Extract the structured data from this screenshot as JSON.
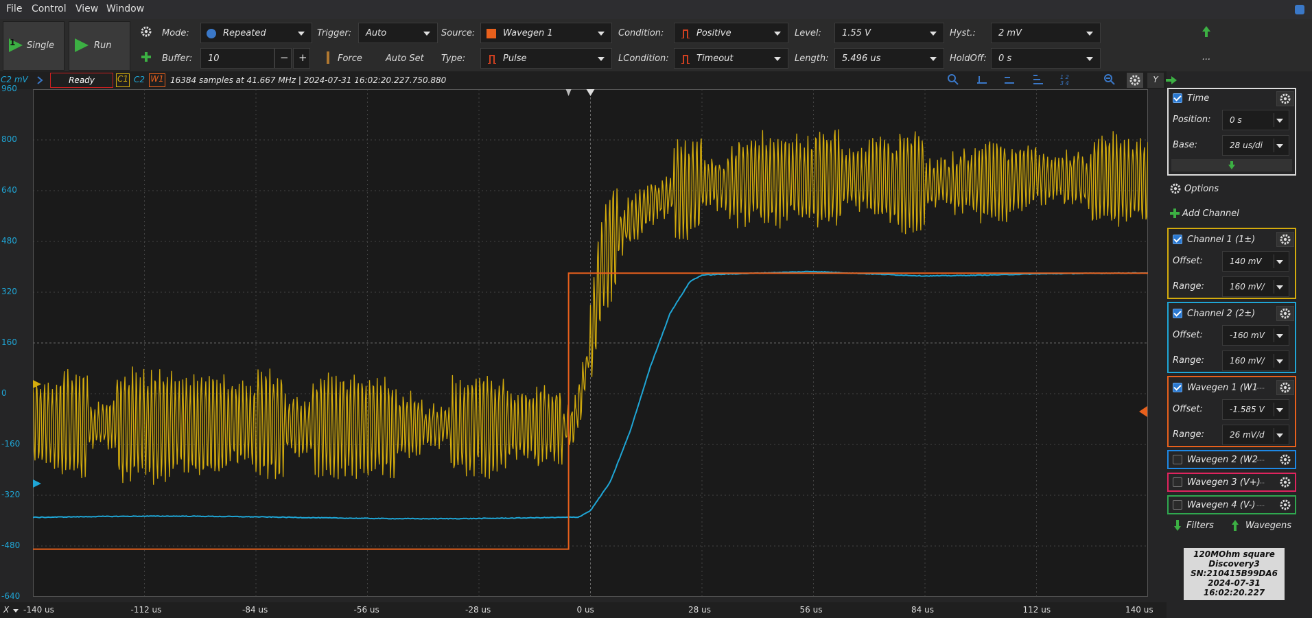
{
  "menu": {
    "items": [
      "File",
      "Control",
      "View",
      "Window"
    ]
  },
  "toolbar": {
    "single": "Single",
    "single_badge": "1",
    "run": "Run",
    "mode_label": "Mode:",
    "mode_value": "Repeated",
    "trigger_label": "Trigger:",
    "trigger_value": "Auto",
    "source_label": "Source:",
    "source_value": "Wavegen 1",
    "condition_label": "Condition:",
    "condition_value": "Positive",
    "level_label": "Level:",
    "level_value": "1.55 V",
    "hyst_label": "Hyst.:",
    "hyst_value": "2 mV",
    "buffer_label": "Buffer:",
    "buffer_value": "10",
    "force": "Force",
    "autoset": "Auto Set",
    "type_label": "Type:",
    "type_value": "Pulse",
    "lcondition_label": "LCondition:",
    "lcondition_value": "Timeout",
    "length_label": "Length:",
    "length_value": "5.496 us",
    "holdoff_label": "HoldOff:",
    "holdoff_value": "0 s",
    "more": "..."
  },
  "status": {
    "axis_unit": "C2 mV",
    "state": "Ready",
    "c1": "C1",
    "c2": "C2",
    "w1": "W1",
    "info": "16384 samples at 41.667 MHz  | 2024-07-31 16:02:20.227.750.880",
    "y_label": "Y"
  },
  "yaxis": {
    "ticks": [
      "960",
      "800",
      "640",
      "480",
      "320",
      "160",
      "0",
      "-160",
      "-320",
      "-480",
      "-640"
    ]
  },
  "xaxis": {
    "label": "X",
    "ticks": [
      "-140 us",
      "-112 us",
      "-84 us",
      "-56 us",
      "-28 us",
      "0 us",
      "28 us",
      "56 us",
      "84 us",
      "112 us",
      "140 us"
    ]
  },
  "colors": {
    "c1": "#d4ac0d",
    "c2": "#1fa6d6",
    "w1": "#e8601c",
    "wg2": "#1e88e5",
    "wg3": "#e0245e",
    "wg4": "#2fa84f",
    "time": "#dddddd"
  },
  "side": {
    "time": {
      "title": "Time",
      "position_label": "Position:",
      "position_value": "0 s",
      "base_label": "Base:",
      "base_value": "28 us/di"
    },
    "options": "Options",
    "add_channel": "Add Channel",
    "ch1": {
      "title": "Channel 1 (1±)",
      "offset_label": "Offset:",
      "offset_value": "140 mV",
      "range_label": "Range:",
      "range_value": "160 mV/"
    },
    "ch2": {
      "title": "Channel 2 (2±)",
      "offset_label": "Offset:",
      "offset_value": "-160 mV",
      "range_label": "Range:",
      "range_value": "160 mV/"
    },
    "wg1": {
      "title": "Wavegen 1 (W1",
      "offset_label": "Offset:",
      "offset_value": "-1.585 V",
      "range_label": "Range:",
      "range_value": "26 mV/d"
    },
    "wg2": {
      "title": "Wavegen 2 (W2"
    },
    "wg3": {
      "title": "Wavegen 3 (V+)"
    },
    "wg4": {
      "title": "Wavegen 4 (V-)"
    },
    "dashes": "---",
    "filters": "Filters",
    "wavegens": "Wavegens"
  },
  "device": {
    "line1": "120MOhm square",
    "line2": "Discovery3",
    "line3": "SN:210415B99DA6",
    "line4": "2024-07-31 16:02:20.227"
  },
  "chart_data": {
    "type": "line",
    "x_unit": "us",
    "xlim": [
      -140,
      140
    ],
    "ylim": [
      -640,
      960
    ],
    "grid": true,
    "series": [
      {
        "name": "C1",
        "kind": "noisy-step",
        "x": [
          -140,
          -5,
          -3,
          0,
          3,
          8,
          15,
          28,
          56,
          84,
          112,
          140
        ],
        "y": [
          -100,
          -100,
          -50,
          150,
          420,
          520,
          600,
          660,
          680,
          660,
          680,
          670
        ],
        "noise_amplitude": 120
      },
      {
        "name": "C2",
        "kind": "smooth-step",
        "x": [
          -140,
          -28,
          -3,
          0,
          5,
          10,
          15,
          20,
          25,
          28,
          56,
          84,
          112,
          140
        ],
        "y": [
          -390,
          -390,
          -390,
          -370,
          -280,
          -120,
          80,
          250,
          350,
          370,
          385,
          375,
          380,
          378
        ],
        "noise_amplitude": 4
      },
      {
        "name": "W1",
        "kind": "pulse",
        "x": [
          -140,
          -5.5,
          -5.5,
          140
        ],
        "y": [
          -490,
          -490,
          380,
          380
        ]
      }
    ]
  }
}
